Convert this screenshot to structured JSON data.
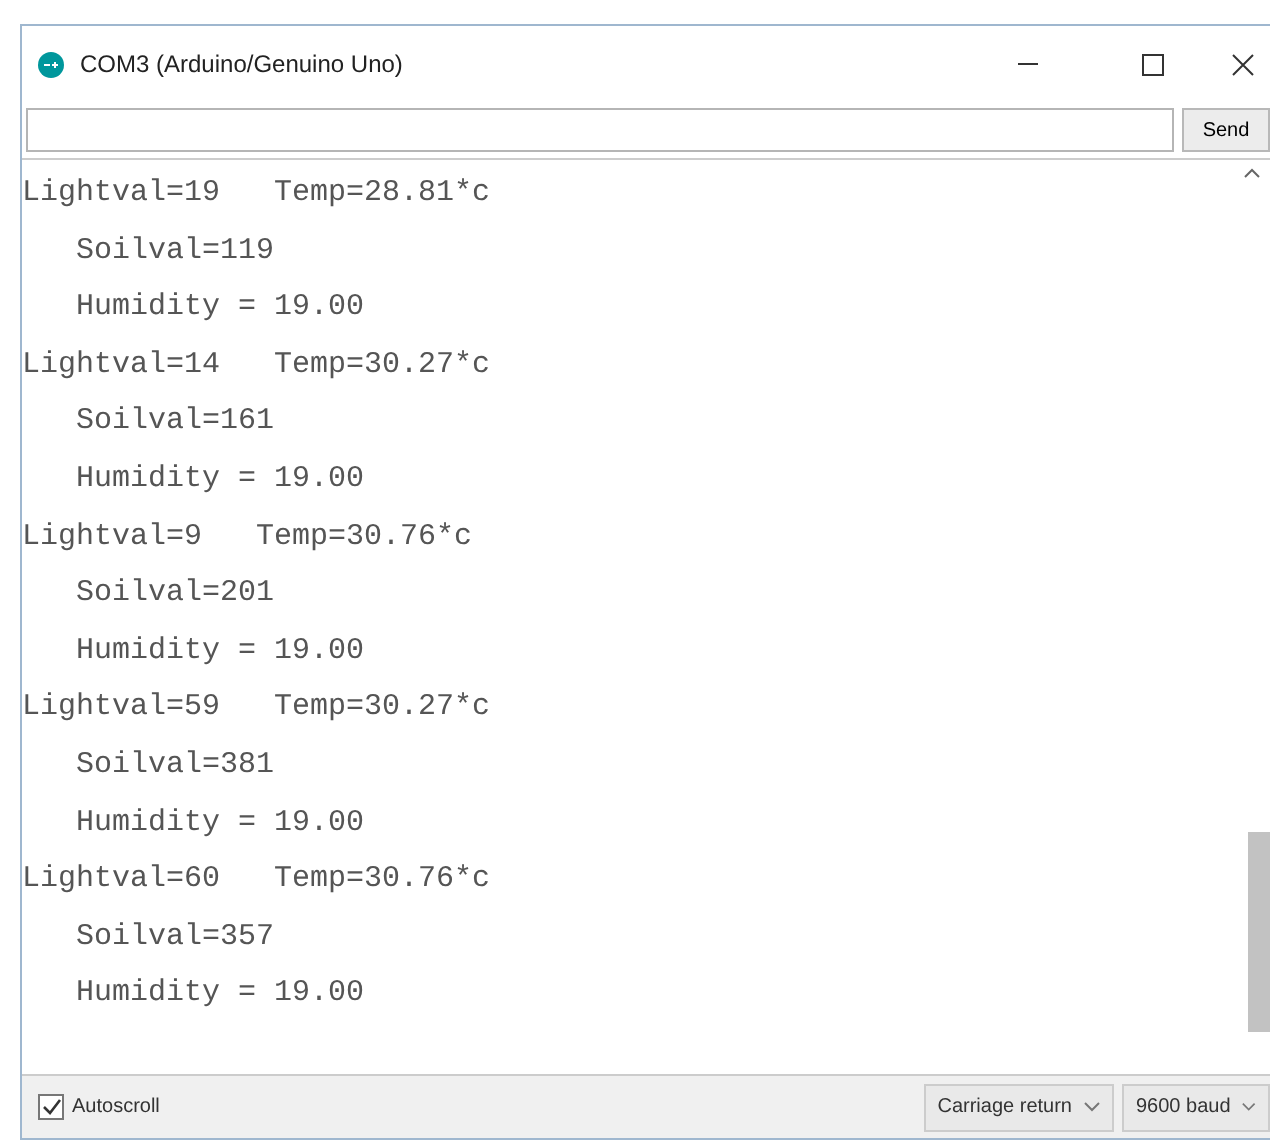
{
  "window": {
    "title": "COM3 (Arduino/Genuino Uno)"
  },
  "send_button": "Send",
  "output": [
    {
      "kind": "main",
      "text": "Lightval=19   Temp=28.81*c"
    },
    {
      "kind": "sub",
      "text": "Soilval=119"
    },
    {
      "kind": "sub",
      "text": "Humidity = 19.00"
    },
    {
      "kind": "main",
      "text": "Lightval=14   Temp=30.27*c"
    },
    {
      "kind": "sub",
      "text": "Soilval=161"
    },
    {
      "kind": "sub",
      "text": "Humidity = 19.00"
    },
    {
      "kind": "main",
      "text": "Lightval=9   Temp=30.76*c"
    },
    {
      "kind": "sub",
      "text": "Soilval=201"
    },
    {
      "kind": "sub",
      "text": "Humidity = 19.00"
    },
    {
      "kind": "main",
      "text": "Lightval=59   Temp=30.27*c"
    },
    {
      "kind": "sub",
      "text": "Soilval=381"
    },
    {
      "kind": "sub",
      "text": "Humidity = 19.00"
    },
    {
      "kind": "main",
      "text": "Lightval=60   Temp=30.76*c"
    },
    {
      "kind": "sub",
      "text": "Soilval=357"
    },
    {
      "kind": "sub",
      "text": "Humidity = 19.00"
    }
  ],
  "autoscroll": {
    "label": "Autoscroll",
    "checked": true
  },
  "line_ending": "Carriage return",
  "baud_rate": "9600 baud"
}
